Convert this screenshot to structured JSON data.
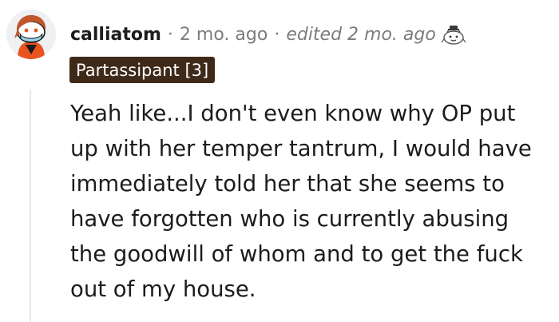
{
  "comment": {
    "username": "calliatom",
    "separator": "·",
    "timestamp": "2 mo. ago",
    "edited": "edited 2 mo. ago",
    "award_icon": "wholesome-seal-award-icon",
    "flair": "Partassipant [3]",
    "body_lines": [
      "Yeah like...I don't even know why OP put",
      "up with her temper tantrum, I would have",
      "immediately told her that she seems to",
      "have forgotten who is currently abusing",
      "the goodwill of whom and to get the fuck",
      "out of my house."
    ]
  },
  "colors": {
    "text": "#1c1c1c",
    "meta": "#7c7c7c",
    "flair_bg": "#3f2a1a",
    "flair_text": "#ffffff",
    "thread_line": "#e5e8ea",
    "avatar_accent": "#e8551f"
  }
}
